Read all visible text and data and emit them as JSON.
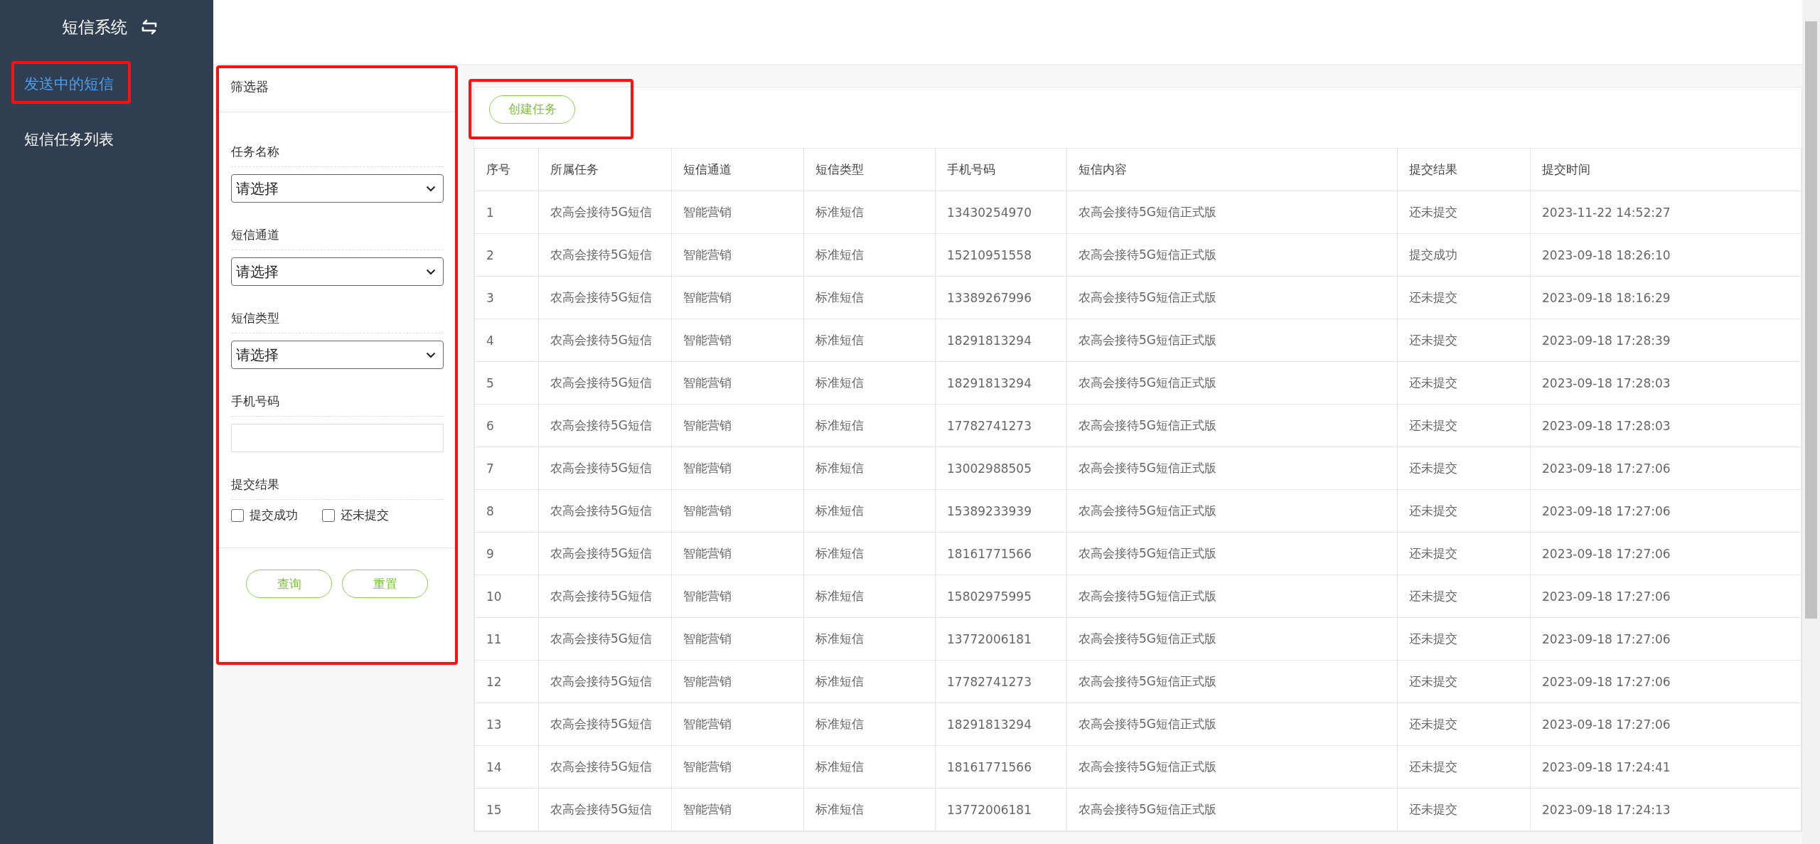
{
  "sidebar": {
    "title": "短信系统",
    "items": [
      {
        "label": "发送中的短信",
        "selected": true,
        "highlighted": true
      },
      {
        "label": "短信任务列表",
        "selected": false,
        "highlighted": false
      }
    ]
  },
  "filter": {
    "title": "筛选器",
    "highlighted": true,
    "fields": [
      {
        "kind": "select",
        "label": "任务名称",
        "value": "请选择"
      },
      {
        "kind": "select",
        "label": "短信通道",
        "value": "请选择"
      },
      {
        "kind": "select",
        "label": "短信类型",
        "value": "请选择"
      },
      {
        "kind": "text",
        "label": "手机号码"
      },
      {
        "kind": "checkboxes",
        "label": "提交结果",
        "options": [
          {
            "label": "提交成功",
            "checked": false
          },
          {
            "label": "还未提交",
            "checked": false
          }
        ]
      }
    ],
    "buttons": [
      "查询",
      "重置"
    ]
  },
  "toolbar": {
    "highlighted": true,
    "button": "创建任务"
  },
  "table": {
    "columns": [
      "序号",
      "所属任务",
      "短信通道",
      "短信类型",
      "手机号码",
      "短信内容",
      "提交结果",
      "提交时间"
    ],
    "rows": [
      [
        "1",
        "农高会接待5G短信",
        "智能营销",
        "标准短信",
        "13430254970",
        "农高会接待5G短信正式版",
        "还未提交",
        "2023-11-22 14:52:27"
      ],
      [
        "2",
        "农高会接待5G短信",
        "智能营销",
        "标准短信",
        "15210951558",
        "农高会接待5G短信正式版",
        "提交成功",
        "2023-09-18 18:26:10"
      ],
      [
        "3",
        "农高会接待5G短信",
        "智能营销",
        "标准短信",
        "13389267996",
        "农高会接待5G短信正式版",
        "还未提交",
        "2023-09-18 18:16:29"
      ],
      [
        "4",
        "农高会接待5G短信",
        "智能营销",
        "标准短信",
        "18291813294",
        "农高会接待5G短信正式版",
        "还未提交",
        "2023-09-18 17:28:39"
      ],
      [
        "5",
        "农高会接待5G短信",
        "智能营销",
        "标准短信",
        "18291813294",
        "农高会接待5G短信正式版",
        "还未提交",
        "2023-09-18 17:28:03"
      ],
      [
        "6",
        "农高会接待5G短信",
        "智能营销",
        "标准短信",
        "17782741273",
        "农高会接待5G短信正式版",
        "还未提交",
        "2023-09-18 17:28:03"
      ],
      [
        "7",
        "农高会接待5G短信",
        "智能营销",
        "标准短信",
        "13002988505",
        "农高会接待5G短信正式版",
        "还未提交",
        "2023-09-18 17:27:06"
      ],
      [
        "8",
        "农高会接待5G短信",
        "智能营销",
        "标准短信",
        "15389233939",
        "农高会接待5G短信正式版",
        "还未提交",
        "2023-09-18 17:27:06"
      ],
      [
        "9",
        "农高会接待5G短信",
        "智能营销",
        "标准短信",
        "18161771566",
        "农高会接待5G短信正式版",
        "还未提交",
        "2023-09-18 17:27:06"
      ],
      [
        "10",
        "农高会接待5G短信",
        "智能营销",
        "标准短信",
        "15802975995",
        "农高会接待5G短信正式版",
        "还未提交",
        "2023-09-18 17:27:06"
      ],
      [
        "11",
        "农高会接待5G短信",
        "智能营销",
        "标准短信",
        "13772006181",
        "农高会接待5G短信正式版",
        "还未提交",
        "2023-09-18 17:27:06"
      ],
      [
        "12",
        "农高会接待5G短信",
        "智能营销",
        "标准短信",
        "17782741273",
        "农高会接待5G短信正式版",
        "还未提交",
        "2023-09-18 17:27:06"
      ],
      [
        "13",
        "农高会接待5G短信",
        "智能营销",
        "标准短信",
        "18291813294",
        "农高会接待5G短信正式版",
        "还未提交",
        "2023-09-18 17:27:06"
      ],
      [
        "14",
        "农高会接待5G短信",
        "智能营销",
        "标准短信",
        "18161771566",
        "农高会接待5G短信正式版",
        "还未提交",
        "2023-09-18 17:24:41"
      ],
      [
        "15",
        "农高会接待5G短信",
        "智能营销",
        "标准短信",
        "13772006181",
        "农高会接待5G短信正式版",
        "还未提交",
        "2023-09-18 17:24:13"
      ]
    ]
  }
}
